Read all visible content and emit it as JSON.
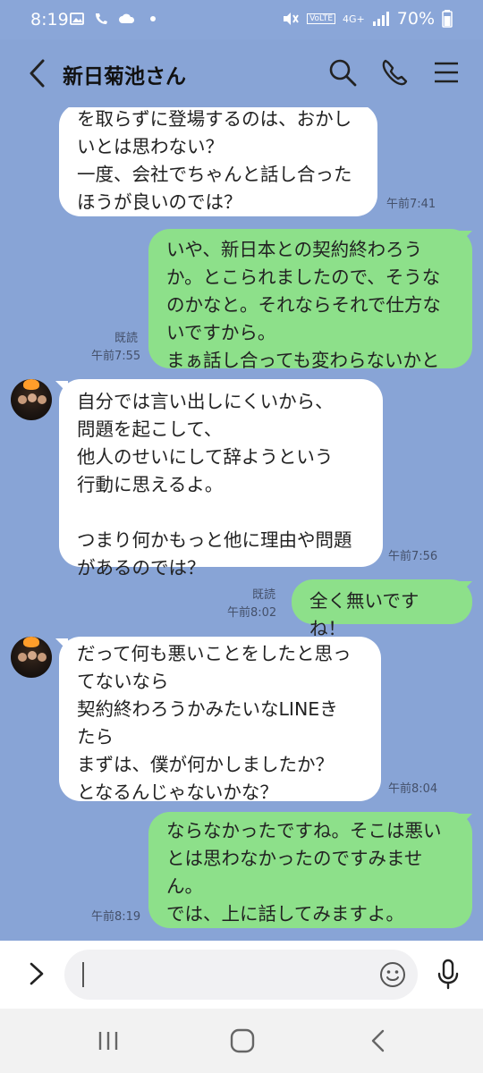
{
  "status_bar": {
    "time": "8:19",
    "network": "4G+",
    "volte": "VoLTE",
    "battery": "70%"
  },
  "header": {
    "title": "新日菊池さん",
    "icons": [
      "back-icon",
      "search-icon",
      "phone-icon",
      "menu-icon"
    ]
  },
  "messages": [
    {
      "side": "in",
      "text": "を取らずに登場するのは、おかし\nいとは思わない？\n一度、会社でちゃんと話し合った\nほうが良いのでは？",
      "time": "午前7:41"
    },
    {
      "side": "out",
      "text": "いや、新日本との契約終わろう\nか。とこられましたので、そうな\nのかなと。それならそれで仕方な\nいですから。\nまぁ話し合っても変わらないかと",
      "read": "既読",
      "time": "午前7:55"
    },
    {
      "side": "in",
      "text": "自分では言い出しにくいから、\n問題を起こして、\n他人のせいにして辞ようという\n行動に思えるよ。\n\nつまり何かもっと他に理由や問題\nがあるのでは？",
      "time": "午前7:56"
    },
    {
      "side": "out",
      "text": "全く無いですね！",
      "read": "既読",
      "time": "午前8:02"
    },
    {
      "side": "in",
      "text": "だって何も悪いことをしたと思っ\nてないなら\n契約終わろうかみたいなLINEき\nたら\nまずは、僕が何かしましたか？\nとなるんじゃないかな？",
      "time": "午前8:04"
    },
    {
      "side": "out",
      "text": "ならなかったですね。そこは悪い\nとは思わなかったのですみませ\nん。\nでは、上に話してみますよ。",
      "time": "午前8:19"
    }
  ],
  "input": {
    "placeholder": ""
  },
  "colors": {
    "background": "#88a4d6",
    "incoming_bubble": "#ffffff",
    "outgoing_bubble": "#8de08a"
  }
}
